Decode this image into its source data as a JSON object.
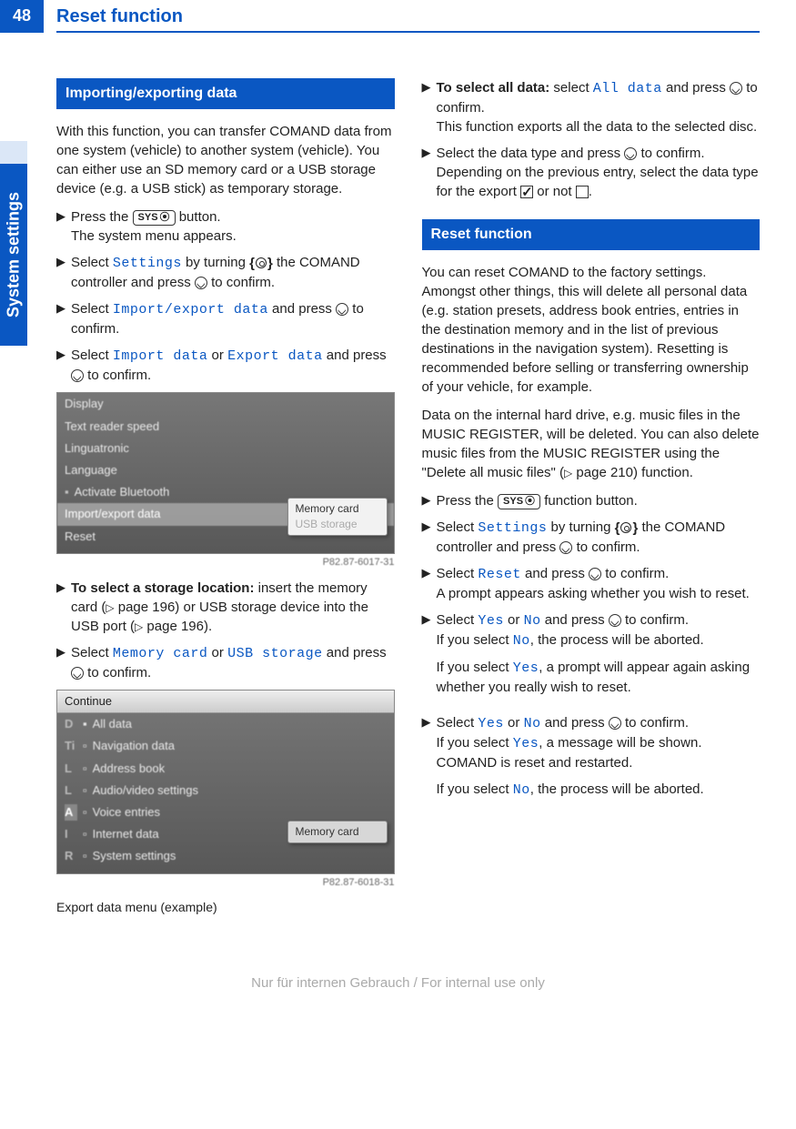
{
  "header": {
    "pageNumber": "48",
    "title": "Reset function",
    "sideTab": "System settings"
  },
  "left": {
    "sectionTitle": "Importing/exporting data",
    "intro": "With this function, you can transfer COMAND data from one system (vehicle) to another system (vehicle). You can either use an SD memory card or a USB storage device (e.g. a USB stick) as temporary storage.",
    "step1a": "Press the ",
    "step1b": " button.",
    "step1c": "The system menu appears.",
    "sysLabel": "SYS",
    "step2a": "Select ",
    "step2b": " by turning ",
    "step2c": " the COMAND controller and press ",
    "step2d": " to confirm.",
    "settings": "Settings",
    "step3a": "Select ",
    "step3b": " and press ",
    "step3c": " to confirm.",
    "importExport": "Import/export data",
    "step4a": "Select ",
    "step4or": " or ",
    "step4b": " and press ",
    "step4c": " to confirm.",
    "importData": "Import data",
    "exportData": "Export data",
    "screenshot1": {
      "items": [
        "Display",
        "Text reader speed",
        "Linguatronic",
        "Language",
        "Activate Bluetooth",
        "Import/export data",
        "Reset"
      ],
      "popup": [
        "Memory card",
        "USB storage"
      ],
      "code": "P82.87-6017-31"
    },
    "step5label": "To select a storage location:",
    "step5a": " insert the memory card (",
    "step5b": " page 196) or USB storage device into the USB port (",
    "step5c": " page 196).",
    "step6a": "Select  ",
    "memoryCard": "Memory card",
    "usbStorage": "USB storage",
    "step6b": " and press ",
    "step6c": " to confirm.",
    "screenshot2": {
      "header": "Continue",
      "items": [
        "All data",
        "Navigation data",
        "Address book",
        "Audio/video settings",
        "Voice entries",
        "Internet data",
        "System settings"
      ],
      "prefixes": [
        "D",
        "Ti",
        "L",
        "L",
        "A",
        "I",
        "R"
      ],
      "side": "Memory card",
      "code": "P82.87-6018-31"
    },
    "caption": "Export data menu (example)"
  },
  "right": {
    "step1label": "To select all data:",
    "step1a": " select ",
    "allData": "All data",
    "step1b": " and press ",
    "step1c": " to confirm.",
    "step1d": "This function exports all the data to the selected disc.",
    "step2a": "Select the data type and press ",
    "step2b": " to confirm.",
    "step2c": "Depending on the previous entry, select the data type for the export ",
    "step2d": " or not ",
    "step2e": ".",
    "sectionTitle": "Reset function",
    "para1": "You can reset COMAND to the factory settings. Amongst other things, this will delete all personal data (e.g. station presets, address book entries, entries in the destination memory and in the list of previous destinations in the navigation system). Resetting is recommended before selling or transferring ownership of your vehicle, for example.",
    "para2a": "Data on the internal hard drive, e.g. music files in the MUSIC REGISTER, will be deleted. You can also delete music files from the MUSIC REGISTER using the \"Delete all music files\" (",
    "para2b": " page 210) function.",
    "step3a": "Press the ",
    "step3b": " function button.",
    "step4a": "Select ",
    "step4b": " by turning ",
    "step4c": " the COMAND controller and press ",
    "step4d": " to confirm.",
    "step5a": "Select ",
    "reset": "Reset",
    "step5b": " and press ",
    "step5c": " to confirm.",
    "step5d": "A prompt appears asking whether you wish to reset.",
    "step6a": "Select ",
    "yes": "Yes",
    "no": "No",
    "step6b": " and press ",
    "step6c": " to confirm.",
    "step6d": "If you select ",
    "step6e": ", the process will be aborted.",
    "step6f": ", a prompt will appear again asking whether you really wish to reset.",
    "step7a": "Select ",
    "step7b": " and press ",
    "step7c": " to confirm.",
    "step7d": "If you select ",
    "step7e": ", a message will be shown. COMAND is reset and restarted.",
    "step7f": ", the process will be aborted."
  },
  "footer": "Nur für internen Gebrauch / For internal use only"
}
